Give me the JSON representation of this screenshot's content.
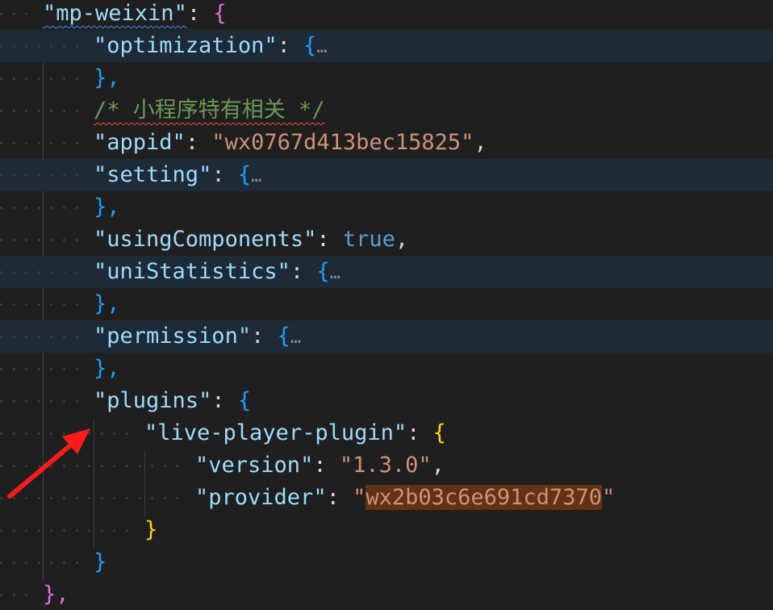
{
  "editor": {
    "lines": [
      {
        "key": "mp-weixin",
        "open": "{"
      },
      {
        "key": "optimization",
        "open": "{",
        "ellipsis": "…"
      },
      {
        "close": "},"
      },
      {
        "comment": "/* 小程序特有相关 */"
      },
      {
        "key": "appid",
        "value": "wx0767d413bec15825"
      },
      {
        "key": "setting",
        "open": "{",
        "ellipsis": "…"
      },
      {
        "close": "},"
      },
      {
        "key": "usingComponents",
        "value": "true"
      },
      {
        "key": "uniStatistics",
        "open": "{",
        "ellipsis": "…"
      },
      {
        "close": "},"
      },
      {
        "key": "permission",
        "open": "{",
        "ellipsis": "…"
      },
      {
        "close": "},"
      },
      {
        "key": "plugins",
        "open": "{"
      },
      {
        "key": "live-player-plugin",
        "open": "{"
      },
      {
        "key": "version",
        "value": "1.3.0"
      },
      {
        "key": "provider",
        "value": "wx2b03c6e691cd7370"
      },
      {
        "close": "}"
      },
      {
        "close": "}"
      },
      {
        "close": "},"
      }
    ]
  },
  "colors": {
    "background": "#1f1f1f",
    "folded_line_highlight": "#1e2a35",
    "property_key": "#9cdcfe",
    "string_value": "#ce9178",
    "comment": "#6a9955",
    "keyword": "#569cd6",
    "selection": "#613214",
    "annotation_arrow": "#ff1a1a"
  },
  "annotation": {
    "icon": "red-arrow-icon"
  }
}
